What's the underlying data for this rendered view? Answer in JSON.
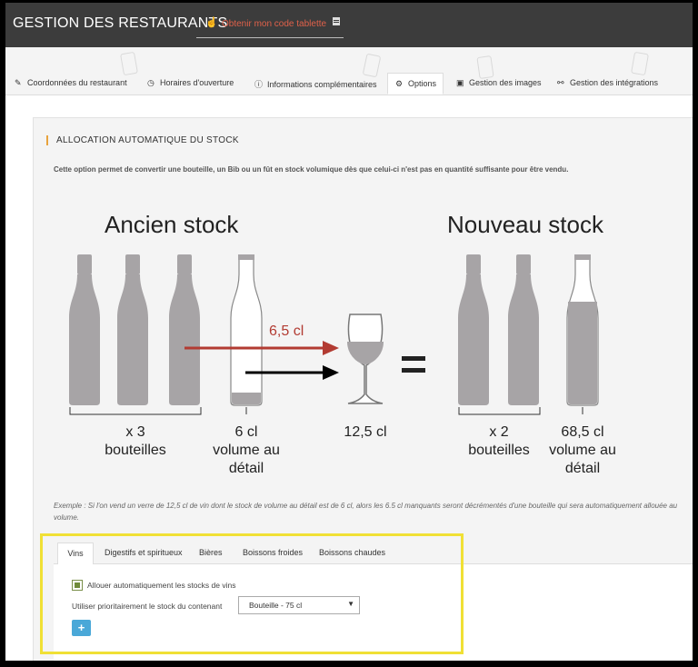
{
  "header": {
    "app_title": "GESTION DES RESTAURANTS",
    "code_link": "Obtenir mon code tablette",
    "code_link_color": "#e0614a",
    "background": "#3c3c3c"
  },
  "tabs": [
    {
      "icon": "edit-icon",
      "label": "Coordonnées du restaurant"
    },
    {
      "icon": "clock-icon",
      "label": "Horaires d'ouverture"
    },
    {
      "icon": "info-icon",
      "label": "Informations complémentaires"
    },
    {
      "icon": "gear-icon",
      "label": "Options",
      "active": true
    },
    {
      "icon": "image-icon",
      "label": "Gestion des images"
    },
    {
      "icon": "link-icon",
      "label": "Gestion des intégrations"
    }
  ],
  "section": {
    "title": "ALLOCATION AUTOMATIQUE  DU STOCK",
    "accent": "#e8a33d",
    "description": "Cette option permet de convertir une bouteille, un Bib ou un fût en stock volumique dès que celui-ci n'est pas en quantité suffisante pour être vendu."
  },
  "illustration": {
    "old_title": "Ancien stock",
    "new_title": "Nouveau stock",
    "arrow_label": "6,5 cl",
    "arrow_color": "#b23b32",
    "old_bottles_caption_1": "x 3",
    "old_bottles_caption_2": "bouteilles",
    "old_retail_caption_1": "6 cl",
    "old_retail_caption_2": "volume au",
    "old_retail_caption_3": "détail",
    "glass_caption": "12,5 cl",
    "new_bottles_caption_1": "x 2",
    "new_bottles_caption_2": "bouteilles",
    "new_retail_caption_1": "68,5 cl",
    "new_retail_caption_2": "volume au",
    "new_retail_caption_3": "détail",
    "equals": "="
  },
  "example": "Exemple : Si l'on vend un verre de 12,5 cl de vin dont le stock de volume au détail est de 6 cl, alors les 6.5 cl manquants seront décrémentés d'une bouteille qui sera automatiquement allouée au volume.",
  "subtabs": [
    {
      "label": "Vins",
      "active": true
    },
    {
      "label": "Digestifs et spiritueux"
    },
    {
      "label": "Bières"
    },
    {
      "label": "Boissons froides"
    },
    {
      "label": "Boissons chaudes"
    }
  ],
  "form": {
    "checkbox_label": "Allouer automatiquement les stocks de vins",
    "checkbox_checked": true,
    "select_label": "Utiliser prioritairement le stock du contenant",
    "select_value": "Bouteille - 75 cl",
    "add_button": "+",
    "add_button_color": "#4aa8d8"
  },
  "highlight_color": "#f0e035"
}
